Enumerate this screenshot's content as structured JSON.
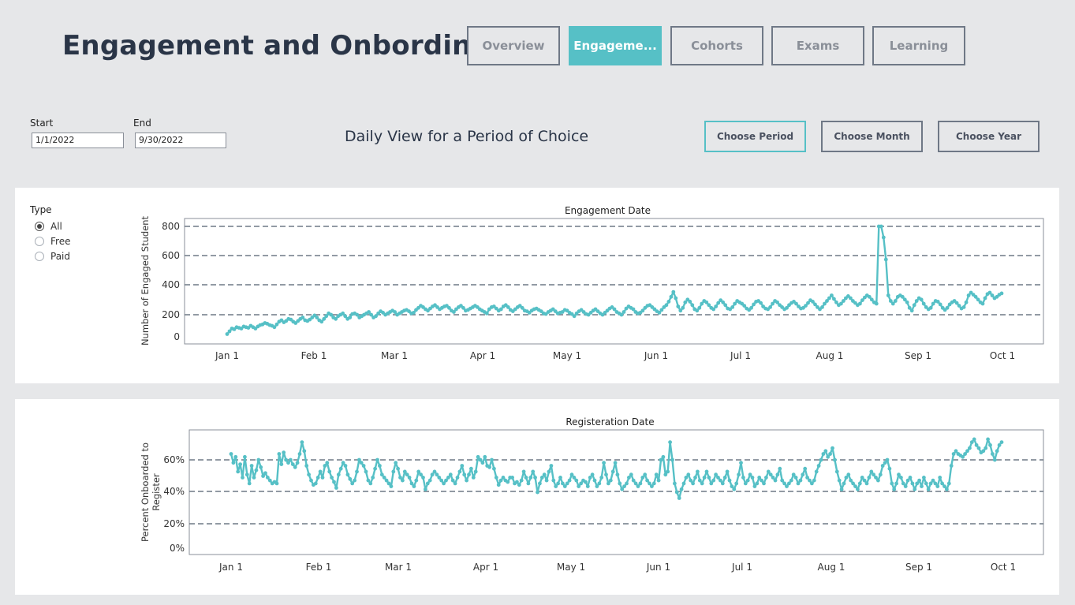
{
  "header": {
    "title": "Engagement and Onbording",
    "tabs": [
      {
        "label": "Overview",
        "active": false
      },
      {
        "label": "Engageme...",
        "active": true
      },
      {
        "label": "Cohorts",
        "active": false
      },
      {
        "label": "Exams",
        "active": false
      },
      {
        "label": "Learning",
        "active": false
      }
    ]
  },
  "filters": {
    "start_label": "Start",
    "start_value": "1/1/2022",
    "end_label": "End",
    "end_value": "9/30/2022",
    "view_title": "Daily View for a Period of Choice",
    "period_buttons": [
      {
        "label": "Choose Period",
        "active": true
      },
      {
        "label": "Choose Month",
        "active": false
      },
      {
        "label": "Choose Year",
        "active": false
      }
    ]
  },
  "type_filter": {
    "title": "Type",
    "options": [
      {
        "label": "All",
        "checked": true
      },
      {
        "label": "Free",
        "checked": false
      },
      {
        "label": "Paid",
        "checked": false
      }
    ]
  },
  "colors": {
    "accent": "#56c0c6",
    "line": "#56c0c6",
    "gridline": "#6f7886"
  },
  "chart_data": [
    {
      "type": "line",
      "title": "Engagement Date",
      "ylabel": "Number of Engaged Student",
      "x_ticks": [
        "Jan 1",
        "Feb 1",
        "Mar 1",
        "Apr 1",
        "May 1",
        "Jun 1",
        "Jul 1",
        "Aug 1",
        "Sep 1",
        "Oct 1"
      ],
      "y_ticks": [
        "0",
        "200",
        "400",
        "600",
        "800"
      ],
      "ylim": [
        0,
        850
      ],
      "grid": "dashed horizontal",
      "x_start": "2022-01-01",
      "series": [
        {
          "values": [
            20,
            40,
            60,
            55,
            70,
            65,
            60,
            75,
            70,
            65,
            80,
            70,
            60,
            75,
            85,
            90,
            100,
            95,
            85,
            80,
            70,
            90,
            110,
            120,
            105,
            115,
            130,
            125,
            110,
            100,
            115,
            130,
            140,
            120,
            115,
            125,
            140,
            155,
            140,
            120,
            110,
            130,
            150,
            170,
            160,
            140,
            130,
            150,
            160,
            170,
            150,
            130,
            140,
            165,
            170,
            160,
            140,
            150,
            160,
            170,
            180,
            160,
            140,
            150,
            170,
            185,
            175,
            160,
            170,
            180,
            190,
            180,
            160,
            170,
            180,
            190,
            195,
            185,
            170,
            175,
            195,
            210,
            225,
            215,
            200,
            190,
            205,
            220,
            230,
            215,
            200,
            210,
            220,
            225,
            210,
            190,
            180,
            200,
            215,
            225,
            210,
            190,
            195,
            205,
            215,
            225,
            215,
            200,
            190,
            180,
            170,
            200,
            215,
            220,
            205,
            190,
            200,
            220,
            230,
            215,
            195,
            185,
            200,
            215,
            225,
            210,
            190,
            185,
            175,
            190,
            200,
            205,
            195,
            185,
            170,
            165,
            180,
            190,
            200,
            185,
            170,
            175,
            180,
            195,
            190,
            175,
            165,
            150,
            170,
            185,
            195,
            180,
            165,
            160,
            175,
            190,
            200,
            185,
            170,
            160,
            175,
            190,
            205,
            215,
            200,
            180,
            170,
            160,
            180,
            205,
            220,
            210,
            200,
            180,
            170,
            175,
            190,
            210,
            225,
            230,
            215,
            200,
            185,
            175,
            195,
            215,
            230,
            255,
            290,
            325,
            280,
            220,
            190,
            210,
            250,
            270,
            255,
            230,
            200,
            190,
            210,
            240,
            260,
            250,
            230,
            210,
            200,
            220,
            245,
            265,
            250,
            230,
            205,
            200,
            215,
            240,
            260,
            250,
            240,
            225,
            205,
            195,
            210,
            235,
            255,
            260,
            245,
            220,
            205,
            200,
            215,
            240,
            260,
            250,
            230,
            215,
            200,
            210,
            230,
            245,
            255,
            240,
            220,
            205,
            210,
            225,
            245,
            265,
            255,
            235,
            215,
            200,
            215,
            240,
            260,
            280,
            300,
            275,
            250,
            230,
            240,
            260,
            280,
            295,
            280,
            260,
            245,
            230,
            240,
            265,
            285,
            300,
            290,
            270,
            250,
            240,
            800,
            800,
            720,
            560,
            300,
            260,
            240,
            260,
            290,
            300,
            290,
            270,
            250,
            210,
            190,
            230,
            260,
            280,
            270,
            240,
            215,
            200,
            210,
            240,
            260,
            255,
            235,
            210,
            195,
            210,
            235,
            250,
            260,
            245,
            225,
            205,
            215,
            250,
            300,
            320,
            305,
            290,
            270,
            250,
            240,
            280,
            310,
            320,
            300,
            280,
            290,
            305,
            315
          ]
        }
      ]
    },
    {
      "type": "line",
      "title": "Registeration Date",
      "ylabel": "Percent Onboarded to Register",
      "x_ticks": [
        "Jan 1",
        "Feb 1",
        "Mar 1",
        "Apr 1",
        "May 1",
        "Jun 1",
        "Jul 1",
        "Aug 1",
        "Sep 1",
        "Oct 1"
      ],
      "y_ticks": [
        "0%",
        "20%",
        "40%",
        "60%"
      ],
      "ylim": [
        0,
        77
      ],
      "grid": "dashed horizontal",
      "x_start": "2022-01-01",
      "series": [
        {
          "values": [
            64,
            58,
            62,
            52,
            57,
            48,
            62,
            50,
            44,
            56,
            48,
            53,
            60,
            55,
            49,
            51,
            48,
            46,
            44,
            45,
            44,
            64,
            57,
            65,
            60,
            58,
            60,
            57,
            55,
            58,
            64,
            72,
            66,
            56,
            50,
            46,
            43,
            44,
            48,
            52,
            48,
            56,
            58,
            52,
            48,
            45,
            41,
            50,
            54,
            58,
            56,
            50,
            47,
            44,
            46,
            52,
            60,
            58,
            56,
            52,
            46,
            44,
            48,
            54,
            60,
            56,
            50,
            48,
            46,
            44,
            42,
            52,
            58,
            54,
            48,
            46,
            52,
            50,
            48,
            44,
            42,
            46,
            52,
            50,
            48,
            40,
            44,
            46,
            50,
            52,
            50,
            48,
            46,
            44,
            46,
            48,
            50,
            46,
            44,
            48,
            52,
            56,
            50,
            46,
            50,
            54,
            48,
            52,
            62,
            60,
            58,
            62,
            56,
            55,
            60,
            54,
            48,
            43,
            46,
            48,
            46,
            45,
            48,
            48,
            44,
            45,
            43,
            46,
            52,
            48,
            44,
            48,
            52,
            48,
            38,
            44,
            48,
            50,
            46,
            52,
            56,
            46,
            42,
            44,
            48,
            44,
            42,
            44,
            46,
            50,
            48,
            46,
            42,
            44,
            46,
            45,
            42,
            48,
            50,
            46,
            42,
            44,
            48,
            58,
            50,
            44,
            46,
            52,
            58,
            50,
            44,
            40,
            42,
            44,
            48,
            50,
            46,
            44,
            42,
            44,
            48,
            50,
            46,
            44,
            42,
            44,
            50,
            46,
            60,
            62,
            50,
            52,
            72,
            60,
            44,
            38,
            34,
            40,
            44,
            48,
            50,
            46,
            44,
            48,
            52,
            46,
            44,
            48,
            52,
            48,
            44,
            46,
            50,
            48,
            46,
            44,
            48,
            52,
            46,
            42,
            40,
            44,
            50,
            58,
            48,
            44,
            46,
            50,
            48,
            42,
            44,
            48,
            46,
            44,
            48,
            52,
            50,
            48,
            46,
            50,
            54,
            46,
            44,
            42,
            44,
            46,
            50,
            48,
            44,
            46,
            50,
            54,
            48,
            46,
            44,
            46,
            52,
            56,
            60,
            64,
            66,
            62,
            64,
            68,
            60,
            52,
            46,
            40,
            44,
            48,
            50,
            46,
            44,
            42,
            40,
            44,
            48,
            46,
            44,
            48,
            52,
            50,
            48,
            46,
            50,
            56,
            58,
            60,
            54,
            44,
            40,
            44,
            50,
            48,
            44,
            42,
            46,
            48,
            44,
            40,
            44,
            46,
            42,
            48,
            44,
            40,
            44,
            46,
            44,
            42,
            48,
            44,
            42,
            40,
            44,
            56,
            64,
            66,
            64,
            63,
            62,
            64,
            66,
            68,
            72,
            74,
            70,
            68,
            65,
            66,
            68,
            74,
            70,
            64,
            60,
            66,
            70,
            72
          ]
        }
      ]
    }
  ]
}
